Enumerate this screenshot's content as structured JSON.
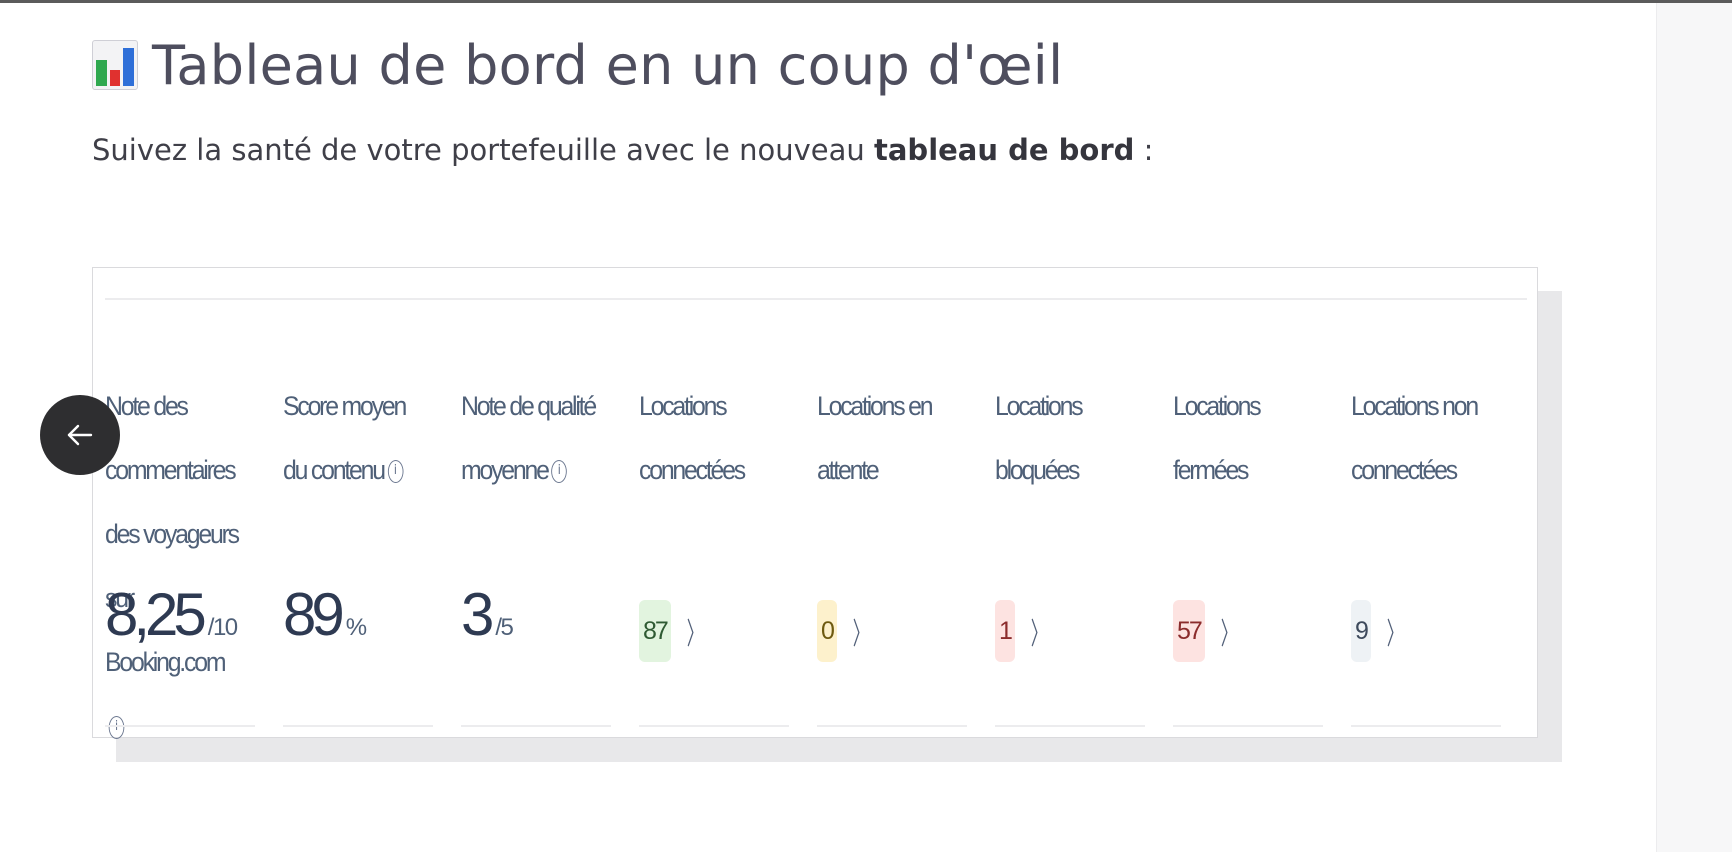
{
  "page": {
    "title_icon": "bar-chart-emoji-icon",
    "title": "Tableau de bord en un coup d'œil",
    "subtitle_prefix": "Suivez la santé de votre portefeuille avec le nouveau ",
    "subtitle_bold": "tableau de bord",
    "subtitle_suffix": " :"
  },
  "dashboard": {
    "rating": {
      "label": "Note des commentaires des voyageurs sur Booking.com",
      "value": "8,25",
      "unit": "/10",
      "icon": "info-icon"
    },
    "content_score": {
      "label": "Score moyen du contenu",
      "value": "89",
      "unit": "%",
      "icon": "info-icon"
    },
    "quality": {
      "label": "Note de qualité moyenne",
      "value": "3",
      "unit": "/5",
      "icon": "info-icon"
    },
    "connected": {
      "label": "Locations connectées",
      "value": "87",
      "color": "#e2f4df",
      "text_color": "#2f5a33"
    },
    "pending": {
      "label": "Locations en attente",
      "value": "0",
      "color": "#fdf1cc",
      "text_color": "#6e5a10"
    },
    "blocked": {
      "label": "Locations bloquées",
      "value": "1",
      "color": "#fde3e1",
      "text_color": "#8b2c2c"
    },
    "closed": {
      "label": "Locations fermées",
      "value": "57",
      "color": "#fde3e1",
      "text_color": "#8b2c2c"
    },
    "not_connected": {
      "label": "Locations non connectées",
      "value": "9",
      "color": "#eef2f5",
      "text_color": "#3e4a5c"
    },
    "chevron": "〉"
  },
  "nav": {
    "back_icon": "arrow-left-icon"
  },
  "colors": {
    "accent_dark": "#2e2e30",
    "title": "#4e4e5e"
  }
}
